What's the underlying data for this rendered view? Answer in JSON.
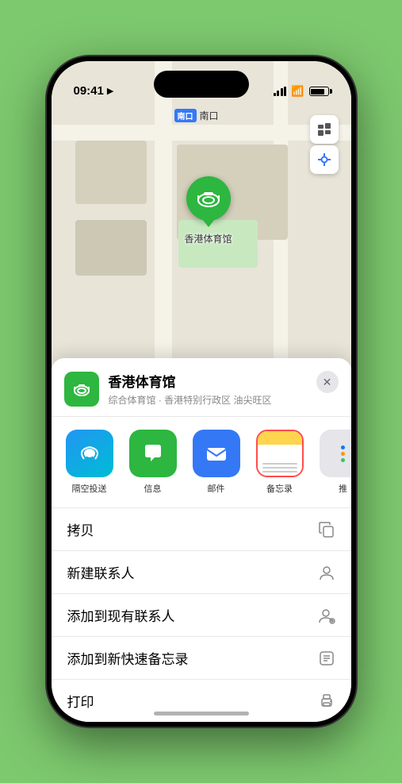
{
  "statusBar": {
    "time": "09:41",
    "locationIcon": "▶"
  },
  "map": {
    "southEntranceTag": "南口",
    "stationLabel": "香港体育馆",
    "pinLabel": "香港体育馆"
  },
  "locationCard": {
    "name": "香港体育馆",
    "description": "综合体育馆 · 香港特别行政区 油尖旺区",
    "closeLabel": "✕"
  },
  "shareItems": [
    {
      "id": "airdrop",
      "label": "隔空投送"
    },
    {
      "id": "message",
      "label": "信息"
    },
    {
      "id": "mail",
      "label": "邮件"
    },
    {
      "id": "notes",
      "label": "备忘录"
    },
    {
      "id": "more",
      "label": "推"
    }
  ],
  "actions": [
    {
      "id": "copy",
      "label": "拷贝",
      "icon": "⧉"
    },
    {
      "id": "new-contact",
      "label": "新建联系人",
      "icon": "👤"
    },
    {
      "id": "add-existing",
      "label": "添加到现有联系人",
      "icon": "👤"
    },
    {
      "id": "add-notes",
      "label": "添加到新快速备忘录",
      "icon": "⊡"
    },
    {
      "id": "print",
      "label": "打印",
      "icon": "🖨"
    }
  ]
}
